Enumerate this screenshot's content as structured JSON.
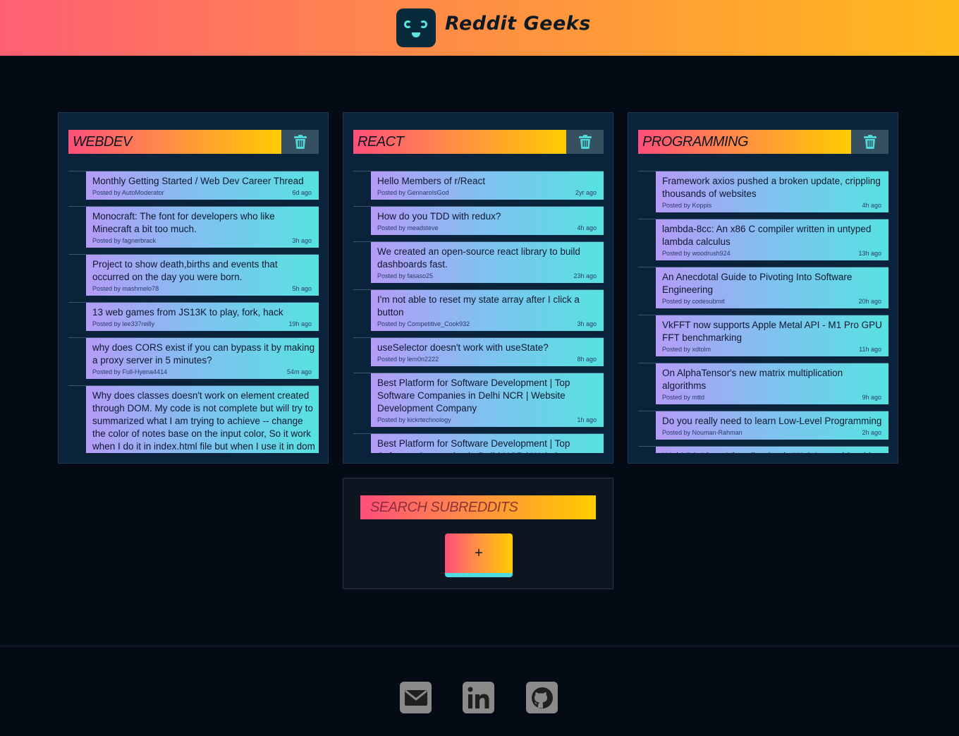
{
  "app": {
    "title": "Reddit Geeks",
    "logo_icon": "robot-face-icon"
  },
  "colors": {
    "header_start": "#ff5f73",
    "header_end": "#ffb91c",
    "accent_cyan": "#56e2e0",
    "background": "#040b14"
  },
  "subreddits": [
    {
      "name": "WEBDEV",
      "delete_icon": "trash-icon",
      "posts": [
        {
          "title": "Monthly Getting Started / Web Dev Career Thread",
          "author": "AutoModerator",
          "ago": "6d ago"
        },
        {
          "title": "Monocraft: The font for developers who like Minecraft a bit too much.",
          "author": "fagnerbrack",
          "ago": "3h ago"
        },
        {
          "title": "Project to show death,births and events that occurred on the day you were born.",
          "author": "mashmelo78",
          "ago": "5h ago"
        },
        {
          "title": "13 web games from JS13K to play, fork, hack",
          "author": "lee337reilly",
          "ago": "19h ago"
        },
        {
          "title": "why does CORS exist if you can bypass it by making a proxy server in 5 minutes?",
          "author": "Full-Hyena4414",
          "ago": "54m ago"
        },
        {
          "title": "Why does classes doesn't work on element created through DOM. My code is not complete but will try to summarized what I am trying to achieve -- change the color of notes base on the input color, So it work when I do it in index.html file but when I use it in dom it doesn't",
          "author": "",
          "ago": ""
        }
      ]
    },
    {
      "name": "REACT",
      "delete_icon": "trash-icon",
      "posts": [
        {
          "title": "Hello Members of r/React",
          "author": "GennaroIsGod",
          "ago": "2yr ago"
        },
        {
          "title": "How do you TDD with redux?",
          "author": "meadsteve",
          "ago": "4h ago"
        },
        {
          "title": "We created an open-source react library to build dashboards fast.",
          "author": "fasaso25",
          "ago": "23h ago"
        },
        {
          "title": "I'm not able to reset my state array after I click a button",
          "author": "Competitive_Cook932",
          "ago": "3h ago"
        },
        {
          "title": "useSelector doesn't work with useState?",
          "author": "lem0n2222",
          "ago": "8h ago"
        },
        {
          "title": "Best Platform for Software Development | Top Software Companies in Delhi NCR | Website Development Company",
          "author": "kickrtechnology",
          "ago": "1h ago"
        },
        {
          "title": "Best Platform for Software Development | Top Software Companies in Delhi NCR | Website",
          "author": "",
          "ago": ""
        }
      ]
    },
    {
      "name": "PROGRAMMING",
      "delete_icon": "trash-icon",
      "posts": [
        {
          "title": "Framework axios pushed a broken update, crippling thousands of websites",
          "author": "Koppis",
          "ago": "4h ago"
        },
        {
          "title": "lambda-8cc: An x86 C compiler written in untyped lambda calculus",
          "author": "woodrush924",
          "ago": "13h ago"
        },
        {
          "title": "An Anecdotal Guide to Pivoting Into Software Engineering",
          "author": "codesubmit",
          "ago": "20h ago"
        },
        {
          "title": "VkFFT now supports Apple Metal API - M1 Pro GPU FFT benchmarking",
          "author": "xdtolm",
          "ago": "11h ago"
        },
        {
          "title": "On AlphaTensor's new matrix multiplication algorithms",
          "author": "mttd",
          "ago": "9h ago"
        },
        {
          "title": "Do you really need to learn Low-Level Programming",
          "author": "Nouman-Rahman",
          "ago": "2h ago"
        },
        {
          "title": "WebVM: Linux Virtualization in WebAssembly with",
          "author": "",
          "ago": ""
        }
      ]
    }
  ],
  "posted_by_prefix": "Posted by",
  "search": {
    "placeholder": "SEARCH SUBREDDITS",
    "add_label": "+"
  },
  "footer": {
    "icons": [
      "envelope-icon",
      "linkedin-icon",
      "github-icon"
    ]
  }
}
